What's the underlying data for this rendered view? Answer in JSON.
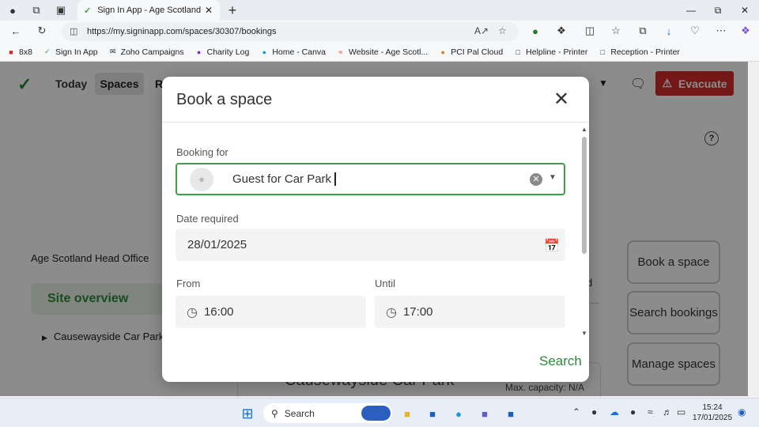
{
  "browser": {
    "tab_title": "Sign In App - Age Scotland",
    "url": "https://my.signinapp.com/spaces/30307/bookings",
    "bookmarks": [
      "8x8",
      "Sign In App",
      "Zoho Campaigns",
      "Charity Log",
      "Home - Canva",
      "Website - Age Scotl...",
      "PCI Pal Cloud",
      "Helpline - Printer",
      "Reception - Printer"
    ]
  },
  "app": {
    "nav": {
      "today": "Today",
      "spaces": "Spaces",
      "partial": "R"
    },
    "evacuate_label": "Evacuate",
    "site_name": "Age Scotland Head Office",
    "site_overview": "Site overview",
    "tree_item": "Causewayside Car Park",
    "side_buttons": [
      "Book a space",
      "Search bookings",
      "Manage spaces"
    ],
    "bg_title": "Causewayside Car Park",
    "bg_capacity": "Max. capacity: N/A",
    "bg_d": "d"
  },
  "modal": {
    "title": "Book a space",
    "booking_for_label": "Booking for",
    "booking_for_value": "Guest for Car Park",
    "date_label": "Date required",
    "date_value": "28/01/2025",
    "from_label": "From",
    "from_value": "16:00",
    "until_label": "Until",
    "until_value": "17:00",
    "search_label": "Search"
  },
  "taskbar": {
    "search_placeholder": "Search",
    "time": "15:24",
    "date": "17/01/2025"
  },
  "colors": {
    "accent_green": "#2a8a3a",
    "evacuate_red": "#d42a2a",
    "field_border": "#3aa243"
  }
}
